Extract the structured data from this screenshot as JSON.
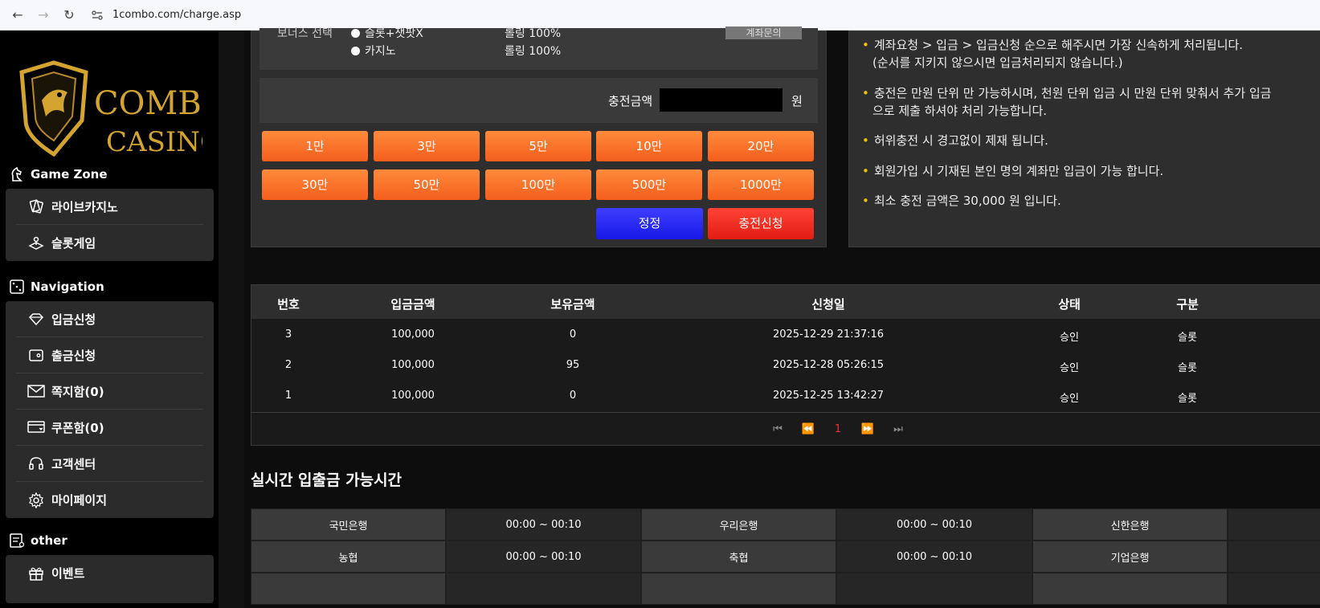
{
  "browser": {
    "url": "1combo.com/charge.asp"
  },
  "brand": {
    "logo_line1": "COMBO",
    "logo_line2": "CASINO",
    "gold": "#d4a431"
  },
  "sidebar": {
    "sections": [
      {
        "title": "Game Zone",
        "icon": "horse-icon",
        "items": [
          {
            "label": "라이브카지노",
            "icon": "cards-icon"
          },
          {
            "label": "슬롯게임",
            "icon": "joystick-icon"
          }
        ]
      },
      {
        "title": "Navigation",
        "icon": "dice-icon",
        "items": [
          {
            "label": "입금신청",
            "icon": "diamond-icon"
          },
          {
            "label": "출금신청",
            "icon": "wallet-icon"
          },
          {
            "label": "쪽지함(0)",
            "icon": "mail-icon"
          },
          {
            "label": "쿠폰함(0)",
            "icon": "coupon-icon"
          },
          {
            "label": "고객센터",
            "icon": "headset-icon"
          },
          {
            "label": "마이페이지",
            "icon": "gear-icon"
          }
        ]
      },
      {
        "title": "other",
        "icon": "note-icon",
        "items": [
          {
            "label": "이벤트",
            "icon": "gift-icon"
          }
        ]
      }
    ]
  },
  "charge": {
    "bonus_label": "보너스 선택",
    "options": [
      {
        "label": "슬롯+잿팟X",
        "rolling": "롤링 100%"
      },
      {
        "label": "카지노",
        "rolling": "롤링 100%"
      }
    ],
    "refund_button": "계좌문의",
    "amount_label": "충전금액",
    "amount_value": "",
    "currency": "원",
    "amount_buttons": [
      "1만",
      "3만",
      "5만",
      "10만",
      "20만",
      "30만",
      "50만",
      "100만",
      "500만",
      "1000만"
    ],
    "reset_button": "정정",
    "submit_button": "충전신청"
  },
  "notices": [
    {
      "text": "계좌요청 > 입금 > 입금신청 순으로 해주시면 가장 신속하게 처리됩니다.",
      "sub": "(순서를 지키지 않으시면 입금처리되지 않습니다.)"
    },
    {
      "text": "충전은 만원 단위 만 가능하시며, 천원 단위 입금 시 만원 단위 맞춰서 추가 입금",
      "sub": "으로 제출 하셔야 처리 가능합니다."
    },
    {
      "text": "허위충전 시 경고없이 제재 됩니다.",
      "sub": ""
    },
    {
      "text": "회원가입 시 기재된 본인 명의 계좌만 입금이 가능 합니다.",
      "sub": ""
    },
    {
      "text": "최소 충전 금액은 30,000 원 입니다.",
      "sub": ""
    }
  ],
  "history": {
    "columns": [
      "번호",
      "입금금액",
      "보유금액",
      "신청일",
      "상태",
      "구분"
    ],
    "rows": [
      [
        "3",
        "100,000",
        "0",
        "2025-12-29 21:37:16",
        "승인",
        "슬롯"
      ],
      [
        "2",
        "100,000",
        "95",
        "2025-12-28 05:26:15",
        "승인",
        "슬롯"
      ],
      [
        "1",
        "100,000",
        "0",
        "2025-12-25 13:42:27",
        "승인",
        "슬롯"
      ]
    ],
    "current_page": "1"
  },
  "realtime": {
    "title": "실시간 입출금 가능시간",
    "banks": [
      [
        {
          "name": "국민은행",
          "time": "00:00 ~ 00:10"
        },
        {
          "name": "우리은행",
          "time": "00:00 ~ 00:10"
        },
        {
          "name": "신한은행",
          "time": ""
        }
      ],
      [
        {
          "name": "농협",
          "time": "00:00 ~ 00:10"
        },
        {
          "name": "축협",
          "time": "00:00 ~ 00:10"
        },
        {
          "name": "기업은행",
          "time": ""
        }
      ]
    ]
  }
}
